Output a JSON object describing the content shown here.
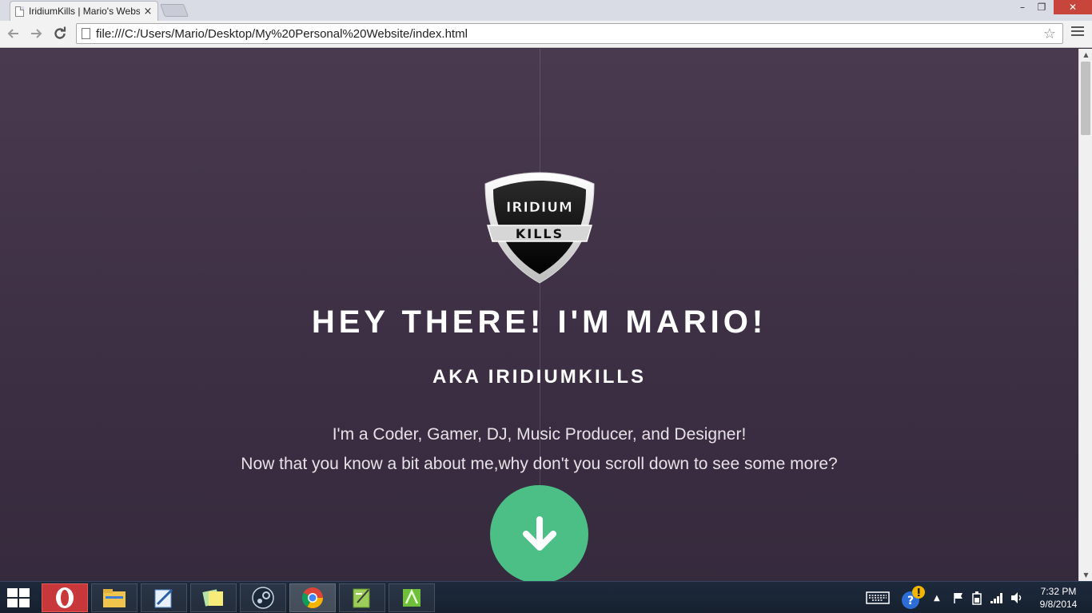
{
  "browser": {
    "tab_title": "IridiumKills | Mario's Website",
    "tab_close": "×",
    "url": "file:///C:/Users/Mario/Desktop/My%20Personal%20Website/index.html",
    "window_controls": {
      "minimize": "–",
      "maximize": "❐",
      "close": "✕"
    }
  },
  "page": {
    "logo": {
      "top_word": "IRIDIUM",
      "bottom_word": "KILLS"
    },
    "title": "HEY THERE! I'M MARIO!",
    "subtitle": "AKA IRIDIUMKILLS",
    "line1": "I'm a Coder, Gamer, DJ, Music Producer, and Designer!",
    "line2": "Now that you know a bit about me,why don't you scroll down to see some more?",
    "accent_color": "#4cbf87",
    "background_color": "#3d2f44"
  },
  "taskbar": {
    "apps": [
      {
        "name": "opera-icon"
      },
      {
        "name": "file-explorer-icon"
      },
      {
        "name": "notepad-icon"
      },
      {
        "name": "sticky-notes-icon"
      },
      {
        "name": "steam-icon"
      },
      {
        "name": "chrome-icon"
      },
      {
        "name": "notepad-plus-plus-icon"
      },
      {
        "name": "app-icon"
      }
    ],
    "clock_time": "7:32 PM",
    "clock_date": "9/8/2014"
  }
}
